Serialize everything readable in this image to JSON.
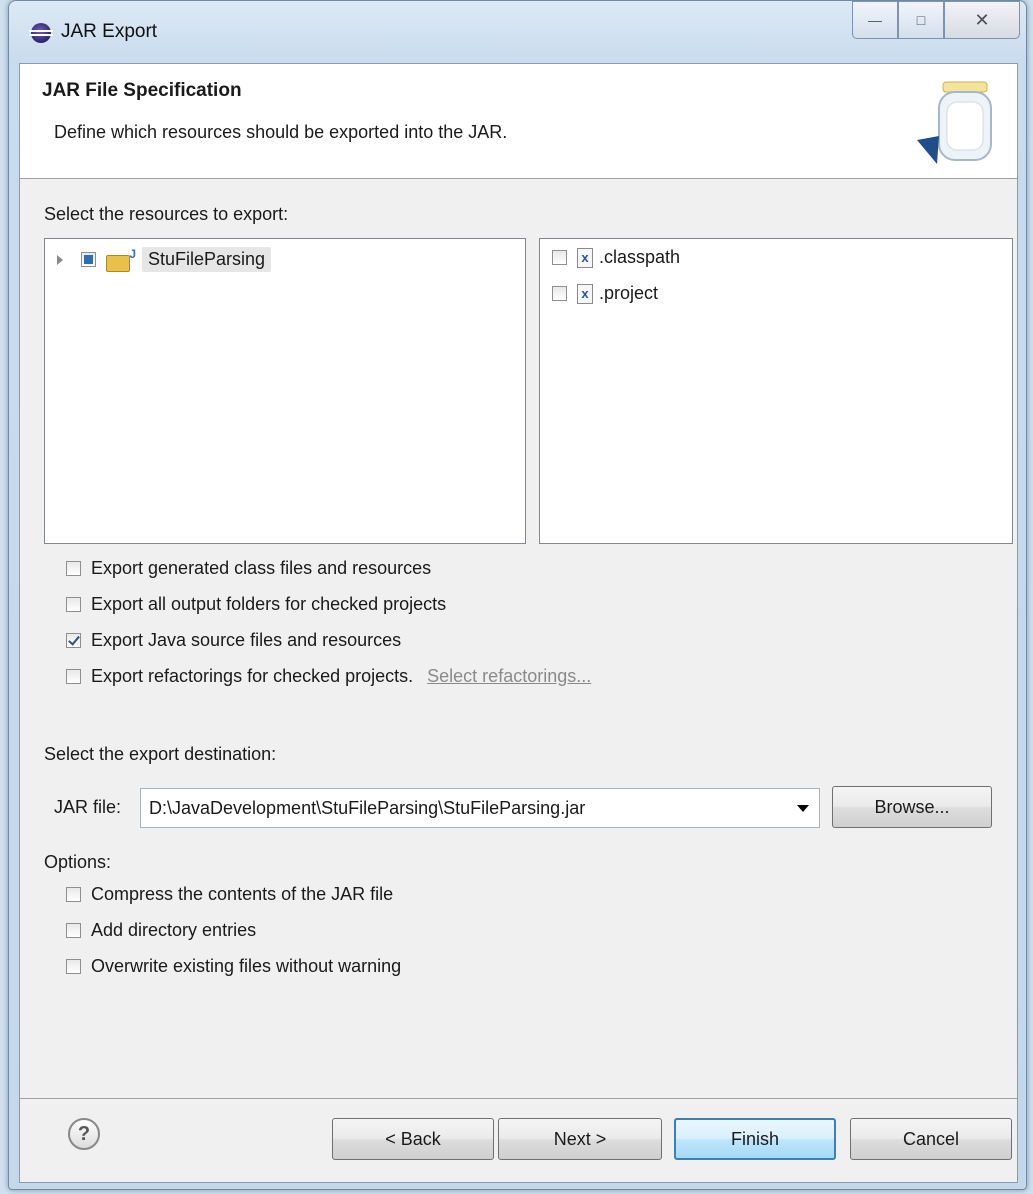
{
  "window": {
    "title": "JAR Export"
  },
  "header": {
    "title": "JAR File Specification",
    "description": "Define which resources should be exported into the JAR."
  },
  "resources": {
    "label": "Select the resources to export:",
    "tree": [
      {
        "label": "StuFileParsing",
        "state": "partial",
        "icon": "java-project-icon"
      }
    ],
    "files": [
      {
        "label": ".classpath",
        "checked": false,
        "icon": "xml-file-icon"
      },
      {
        "label": ".project",
        "checked": false,
        "icon": "xml-file-icon"
      }
    ]
  },
  "export_options": [
    {
      "label": "Export generated class files and resources",
      "checked": false
    },
    {
      "label": "Export all output folders for checked projects",
      "checked": false
    },
    {
      "label": "Export Java source files and resources",
      "checked": true
    },
    {
      "label": "Export refactorings for checked projects.",
      "checked": false,
      "link": "Select refactorings..."
    }
  ],
  "destination": {
    "label": "Select the export destination:",
    "jar_label": "JAR file:",
    "jar_value": "D:\\JavaDevelopment\\StuFileParsing\\StuFileParsing.jar",
    "browse_label": "Browse..."
  },
  "options": {
    "label": "Options:",
    "items": [
      {
        "label": "Compress the contents of the JAR file",
        "checked": false
      },
      {
        "label": "Add directory entries",
        "checked": false
      },
      {
        "label": "Overwrite existing files without warning",
        "checked": false
      }
    ]
  },
  "footer": {
    "help_glyph": "?",
    "back": "< Back",
    "next": "Next >",
    "finish": "Finish",
    "cancel": "Cancel"
  }
}
